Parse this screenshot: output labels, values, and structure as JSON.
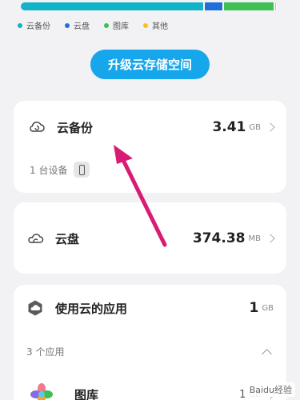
{
  "storage_bar": {
    "segments": [
      {
        "name": "cloud-backup",
        "color": "#12b3c8",
        "fraction": 0.715
      },
      {
        "name": "cloud-drive",
        "color": "#1e6fd9",
        "fraction": 0.075
      },
      {
        "name": "gallery",
        "color": "#3cc152",
        "fraction": 0.2
      },
      {
        "name": "other",
        "color": "#f6c11a",
        "fraction": 0.01
      }
    ]
  },
  "legend": [
    {
      "label": "云备份",
      "color": "#12b3c8"
    },
    {
      "label": "云盘",
      "color": "#1e6fd9"
    },
    {
      "label": "图库",
      "color": "#3cc152"
    },
    {
      "label": "其他",
      "color": "#f6c11a"
    }
  ],
  "upgrade_button": {
    "label": "升级云存储空间"
  },
  "cloud_backup": {
    "title": "云备份",
    "value": "3.41",
    "unit": "GB",
    "devices": "1 台设备",
    "icon": "cloud-refresh-icon"
  },
  "cloud_drive": {
    "title": "云盘",
    "value": "374.38",
    "unit": "MB",
    "icon": "cloud-icon"
  },
  "apps_using_cloud": {
    "title": "使用云的应用",
    "value": "1",
    "unit": "GB",
    "count": "3 个应用",
    "icon": "cloud-hexagon-icon"
  },
  "gallery_app": {
    "title": "图库",
    "value": "1",
    "unit": "GB",
    "icon": "gallery-flower-icon"
  },
  "watermark": "Baidu经验"
}
